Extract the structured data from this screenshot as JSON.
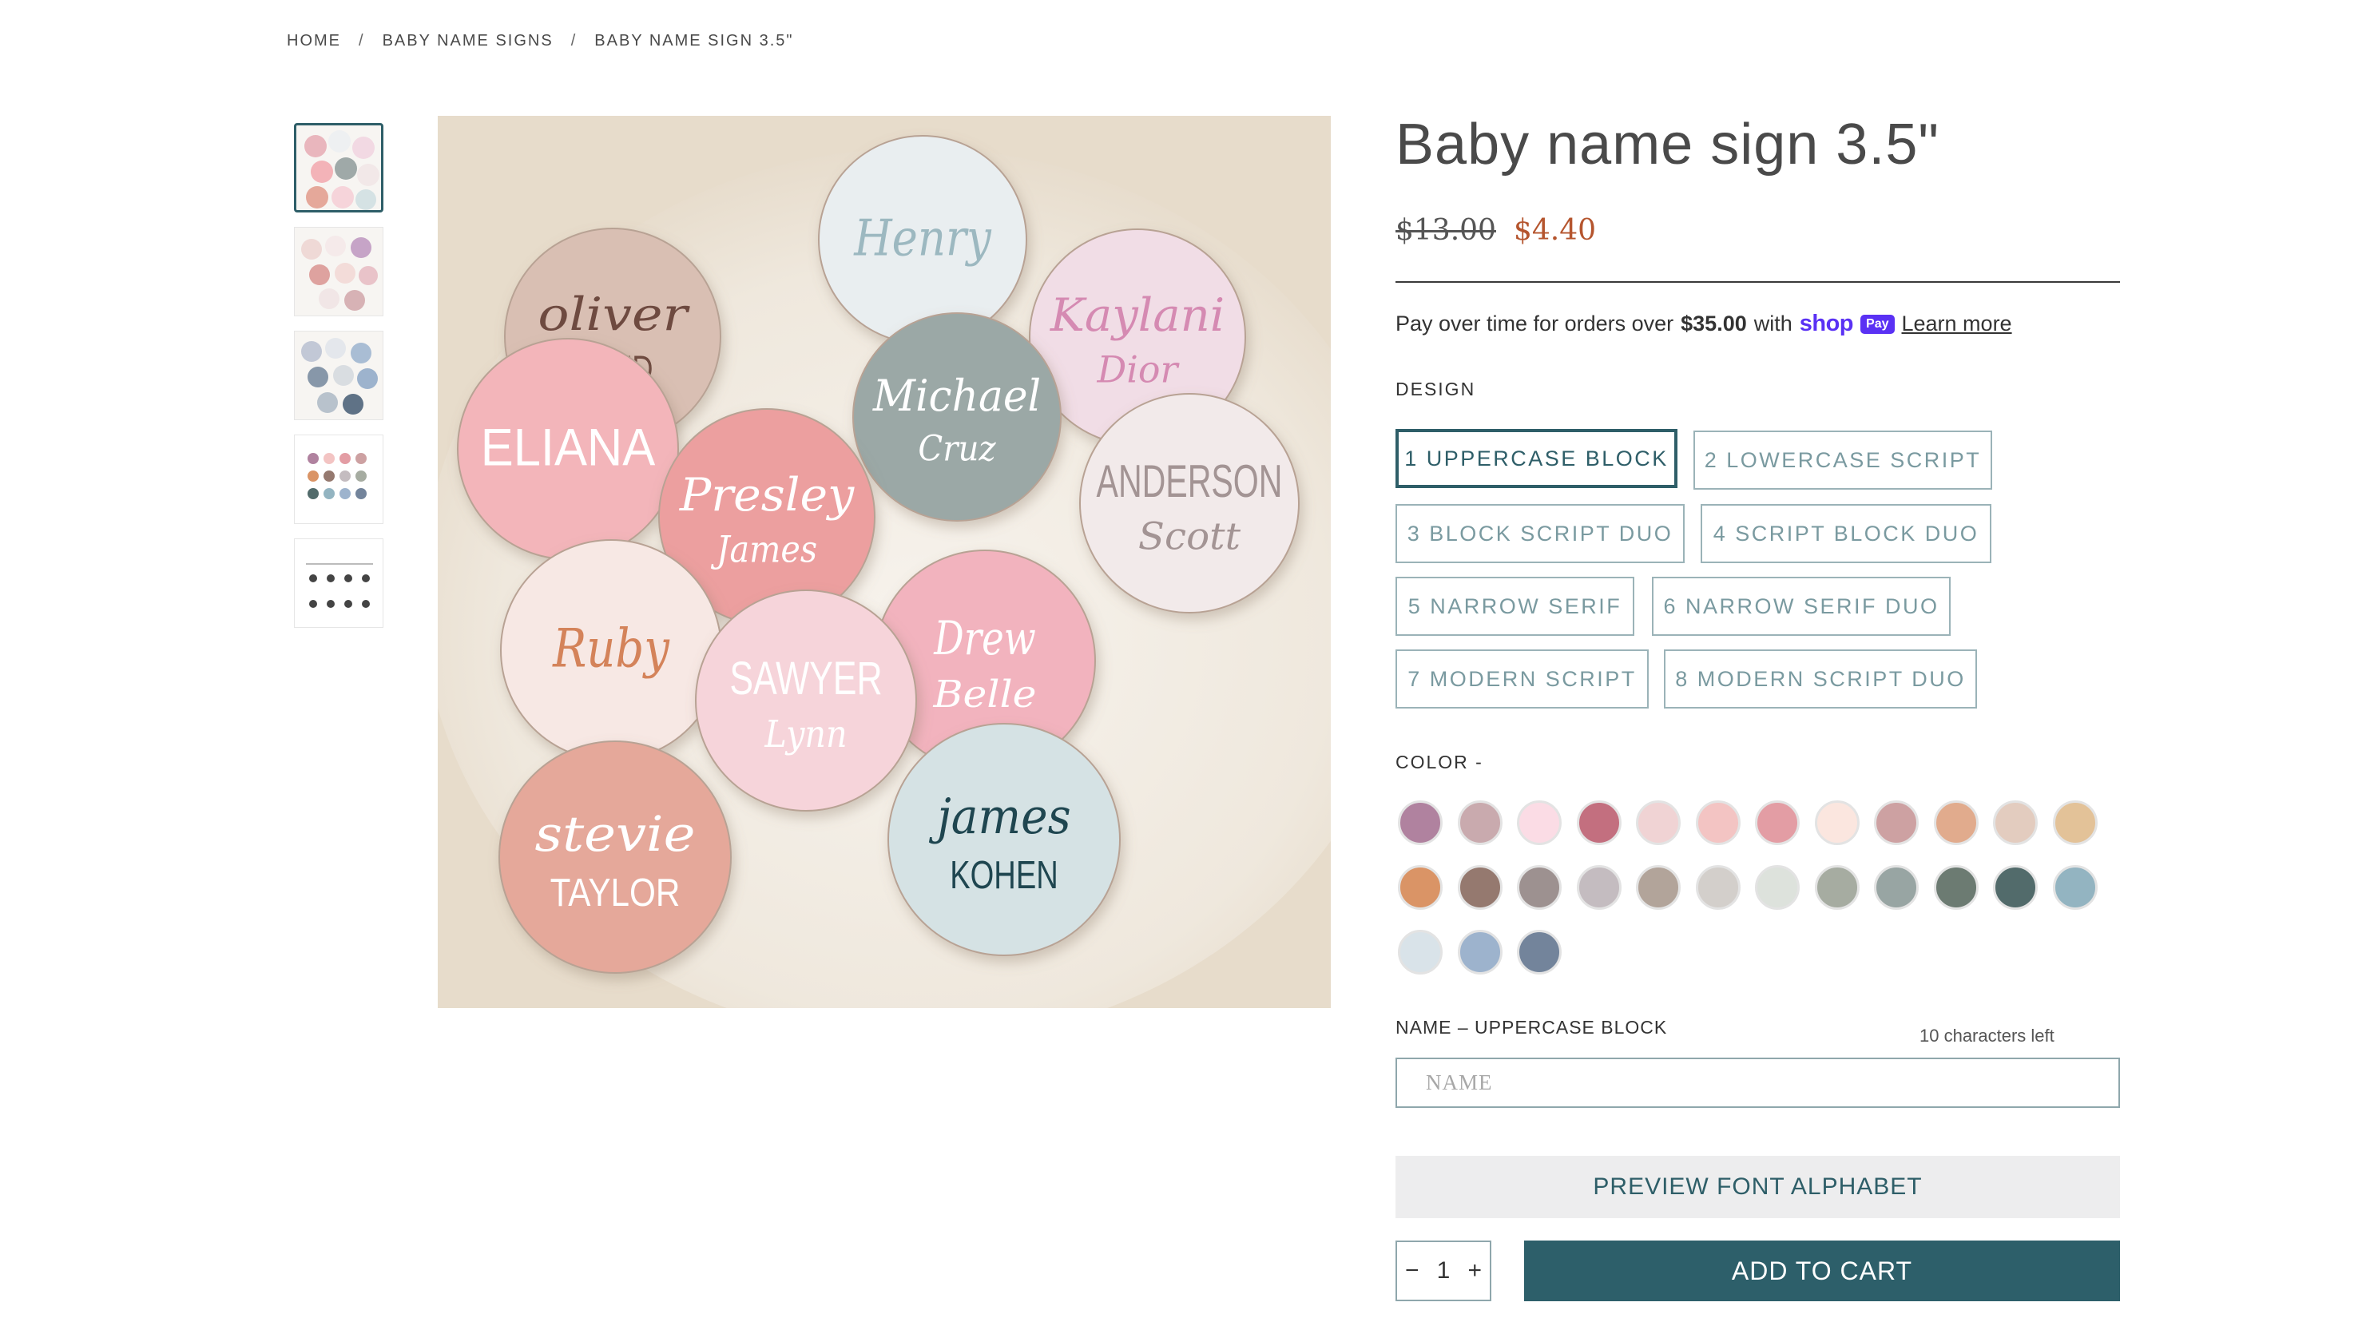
{
  "breadcrumb": {
    "items": [
      "HOME",
      "BABY NAME SIGNS",
      "BABY NAME SIGN 3.5\""
    ],
    "separator": "/"
  },
  "product": {
    "title": "Baby name sign 3.5\"",
    "price_original": "$13.00",
    "price_sale": "$4.40"
  },
  "payment": {
    "text_before": "Pay over time for orders over",
    "amount": "$35.00",
    "text_after": "with",
    "provider_logo": "shop",
    "provider_badge": "Pay",
    "learn_more": "Learn more"
  },
  "design": {
    "label": "DESIGN",
    "selected_index": 0,
    "options": [
      "1 UPPERCASE BLOCK",
      "2 LOWERCASE SCRIPT",
      "3 BLOCK SCRIPT DUO",
      "4 SCRIPT BLOCK DUO",
      "5 NARROW SERIF",
      "6 NARROW SERIF DUO",
      "7 MODERN SCRIPT",
      "8 MODERN SCRIPT DUO"
    ]
  },
  "color": {
    "label": "COLOR -",
    "swatches": [
      "#b0829f",
      "#c9aaae",
      "#fbdce5",
      "#c36f7f",
      "#f0d3d4",
      "#f3c4c3",
      "#e39da4",
      "#fbe6df",
      "#cda1a2",
      "#e1ab8d",
      "#e3ccbf",
      "#e3c298",
      "#da9466",
      "#95796f",
      "#9d9190",
      "#c4bcc0",
      "#b2a49a",
      "#d3cfcb",
      "#dde2dc",
      "#a6aca1",
      "#98a5a3",
      "#6c7b72",
      "#526b6b",
      "#93b4c1",
      "#d9e3e9",
      "#9db3cd",
      "#73849b"
    ]
  },
  "name_field": {
    "label": "NAME – UPPERCASE BLOCK",
    "chars_left": "10 characters left",
    "placeholder": "NAME"
  },
  "buttons": {
    "preview": "PREVIEW FONT ALPHABET",
    "add_to_cart": "ADD TO CART",
    "minus": "−",
    "plus": "+"
  },
  "quantity": "1",
  "gallery": {
    "signs": [
      {
        "line1": "Henry",
        "line2": "",
        "fill": "#e9eef0",
        "color": "#9cb8c0"
      },
      {
        "line1": "oliver",
        "line2": "REED",
        "fill": "#d9bfb3",
        "color": "#6e4a40"
      },
      {
        "line1": "Kaylani",
        "line2": "Dior",
        "fill": "#f1dde6",
        "color": "#d58ab2"
      },
      {
        "line1": "Michael",
        "line2": "Cruz",
        "fill": "#9ba8a6",
        "color": "#ffffff"
      },
      {
        "line1": "ELIANA",
        "line2": "",
        "fill": "#f3b5ba",
        "color": "#ffffff"
      },
      {
        "line1": "Presley",
        "line2": "James",
        "fill": "#ec9f9f",
        "color": "#ffffff"
      },
      {
        "line1": "ANDERSON",
        "line2": "Scott",
        "fill": "#f2eaea",
        "color": "#a39494"
      },
      {
        "line1": "Ruby",
        "line2": "",
        "fill": "#f7e8e4",
        "color": "#d4835a"
      },
      {
        "line1": "Drew",
        "line2": "Belle",
        "fill": "#f2b3be",
        "color": "#ffffff"
      },
      {
        "line1": "SAWYER",
        "line2": "Lynn",
        "fill": "#f6d4da",
        "color": "#ffffff"
      },
      {
        "line1": "stevie",
        "line2": "TAYLOR",
        "fill": "#e5a89a",
        "color": "#ffffff"
      },
      {
        "line1": "james",
        "line2": "KOHEN",
        "fill": "#d5e2e4",
        "color": "#1f4650"
      }
    ]
  }
}
